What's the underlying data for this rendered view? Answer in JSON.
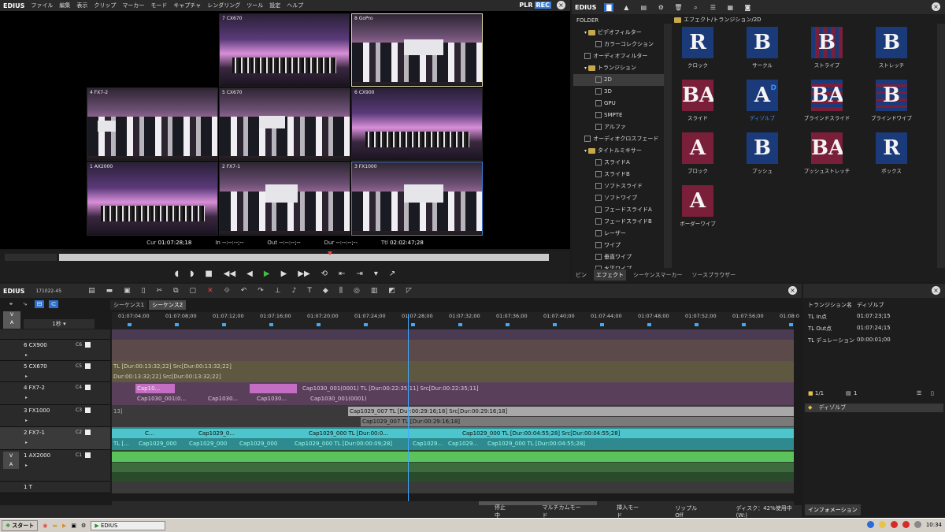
{
  "app": {
    "name": "EDIUS",
    "plr": "PLR",
    "rec": "REC"
  },
  "menu": [
    "ファイル",
    "編集",
    "表示",
    "クリップ",
    "マーカー",
    "モード",
    "キャプチャ",
    "レンダリング",
    "ツール",
    "設定",
    "ヘルプ"
  ],
  "player": {
    "tiles": [
      {
        "label": "7 CX670"
      },
      {
        "label": "8 GoPro"
      },
      {
        "label": "4 FX7-2"
      },
      {
        "label": "5 CX670"
      },
      {
        "label": "6 CX900"
      },
      {
        "label": "1 AX2000"
      },
      {
        "label": "2 FX7-1"
      },
      {
        "label": "3 FX1000"
      }
    ],
    "cur_label": "Cur",
    "cur": "01:07:28;18",
    "in_label": "In",
    "in": "--:--:--;--",
    "out_label": "Out",
    "out": "--:--:--;--",
    "dur_label": "Dur",
    "dur": "--:--:--;--",
    "ttl_label": "Ttl",
    "ttl": "02:02:47;28"
  },
  "effects": {
    "folder_header": "FOLDER",
    "path": "エフェクト/トランジション/2D",
    "tree": [
      {
        "label": "ビデオフィルター",
        "indent": 1,
        "type": "folder"
      },
      {
        "label": "カラーコレクション",
        "indent": 2,
        "type": "fx"
      },
      {
        "label": "オーディオフィルター",
        "indent": 1,
        "type": "fx"
      },
      {
        "label": "トランジション",
        "indent": 1,
        "type": "folder"
      },
      {
        "label": "2D",
        "indent": 2,
        "type": "fx",
        "selected": true
      },
      {
        "label": "3D",
        "indent": 2,
        "type": "fx"
      },
      {
        "label": "GPU",
        "indent": 2,
        "type": "fx"
      },
      {
        "label": "SMPTE",
        "indent": 2,
        "type": "fx"
      },
      {
        "label": "アルファ",
        "indent": 2,
        "type": "fx"
      },
      {
        "label": "オーディオクロスフェード",
        "indent": 1,
        "type": "fx"
      },
      {
        "label": "タイトルミキサー",
        "indent": 1,
        "type": "folder"
      },
      {
        "label": "スライドA",
        "indent": 2,
        "type": "fx"
      },
      {
        "label": "スライドB",
        "indent": 2,
        "type": "fx"
      },
      {
        "label": "ソフトスライド",
        "indent": 2,
        "type": "fx"
      },
      {
        "label": "ソフトワイプ",
        "indent": 2,
        "type": "fx"
      },
      {
        "label": "フェードスライドA",
        "indent": 2,
        "type": "fx"
      },
      {
        "label": "フェードスライドB",
        "indent": 2,
        "type": "fx"
      },
      {
        "label": "レーザー",
        "indent": 2,
        "type": "fx"
      },
      {
        "label": "ワイプ",
        "indent": 2,
        "type": "fx"
      },
      {
        "label": "垂直ワイプ",
        "indent": 2,
        "type": "fx"
      },
      {
        "label": "水平ワイプ",
        "indent": 2,
        "type": "fx"
      }
    ],
    "items": [
      {
        "label": "クロック",
        "glyph": "R"
      },
      {
        "label": "サークル",
        "glyph": "B"
      },
      {
        "label": "ストライプ",
        "glyph": "B"
      },
      {
        "label": "ストレッチ",
        "glyph": "B"
      },
      {
        "label": "スライド",
        "glyph": "BA"
      },
      {
        "label": "ディゾルブ",
        "glyph": "A",
        "selected": true,
        "badge": "D"
      },
      {
        "label": "ブラインドスライド",
        "glyph": "BA"
      },
      {
        "label": "ブラインドワイプ",
        "glyph": "B"
      },
      {
        "label": "ブロック",
        "glyph": "A"
      },
      {
        "label": "プッシュ",
        "glyph": "B"
      },
      {
        "label": "プッシュストレッチ",
        "glyph": "BA"
      },
      {
        "label": "ボックス",
        "glyph": "R"
      },
      {
        "label": "ボーダーワイプ",
        "glyph": "A"
      }
    ],
    "tabs": [
      {
        "label": "ビン"
      },
      {
        "label": "エフェクト",
        "active": true
      },
      {
        "label": "シーケンスマーカー"
      },
      {
        "label": "ソースブラウザー"
      }
    ]
  },
  "timeline": {
    "project": "171022-45",
    "tabs": [
      {
        "label": "シーケンス1"
      },
      {
        "label": "シーケンス2",
        "active": true
      }
    ],
    "scale": "1秒",
    "ruler": [
      "01:07:04;00",
      "01:07:08;00",
      "01:07:12;00",
      "01:07:16;00",
      "01:07:20;00",
      "01:07:24;00",
      "01:07:28;00",
      "01:07:32;00",
      "01:07:36;00",
      "01:07:40;00",
      "01:07:44;00",
      "01:07:48;00",
      "01:07:52;00",
      "01:07:56;00",
      "01:08:0"
    ],
    "tracks": [
      {
        "name": "",
        "ch": ""
      },
      {
        "name": "6 CX900",
        "ch": "C6"
      },
      {
        "name": "5 CX670",
        "ch": "C5"
      },
      {
        "name": "4 FX7-2",
        "ch": "C4"
      },
      {
        "name": "3 FX1000",
        "ch": "C3"
      },
      {
        "name": "2 FX7-1",
        "ch": "C2"
      },
      {
        "name": "1 AX2000",
        "ch": "C1"
      },
      {
        "name": "1 T",
        "ch": ""
      }
    ],
    "clips": {
      "t5a": "TL [Dur:00:13:32;22]  Src[Dur:00:13:32;22]",
      "t5b": "Dur:00:13:32;22]  Src[Dur:00:13:32;22]",
      "t4a1": "Cap10...",
      "t4a2": "Cap1030_001(0001)  TL [Dur:00:22:35;11]  Src[Dur:00:22:35;11]",
      "t4b1": "Cap1030_001(0...",
      "t4b2": "Cap1030...",
      "t4b3": "Cap1030...",
      "t4b4": "Cap1030_001(0001)",
      "t3a0": "13]",
      "t3a": "Cap1029_007  TL [Dur:00:29:16;18]  Src[Dur:00:29:16;18]",
      "t3b": "Cap1029_007  TL [Dur:00:29:16;18]",
      "t2a1": "C...",
      "t2a2": "Cap1029_0...",
      "t2a3": "Cap1029_000  TL [Dur:00:0...",
      "t2a4": "Cap1029_000  TL [Dur:00:04:55;28]  Src[Dur:00:04:55;28]",
      "t2b1": "TL [...",
      "t2b2": "Cap1029_000",
      "t2b3": "Cap1029_000",
      "t2b4": "Cap1029_000",
      "t2b5": "Cap1029_000  TL [Dur:00:00:09;28]",
      "t2b6": "Cap1029...",
      "t2b7": "Cap1029...",
      "t2b8": "Cap1029_000  TL [Dur:00:04:55;28]"
    },
    "status": {
      "state": "停止中",
      "mode1": "マルチカムモード",
      "mode2": "挿入モード",
      "ripple": "リップルOff",
      "disk": "ディスク：42%使用中(W:)"
    }
  },
  "info": {
    "rows": [
      {
        "k": "トランジション名",
        "v": "ディゾルブ"
      },
      {
        "k": "TL In点",
        "v": "01:07:23;15"
      },
      {
        "k": "TL Out点",
        "v": "01:07:24;15"
      },
      {
        "k": "TL デュレーション",
        "v": "00:00:01;00"
      }
    ],
    "page": "1/1",
    "count": "1",
    "item": "ディゾルブ",
    "tab": "インフォメーション"
  },
  "taskbar": {
    "start": "スタート",
    "task": "EDIUS",
    "clock": "10:34"
  }
}
